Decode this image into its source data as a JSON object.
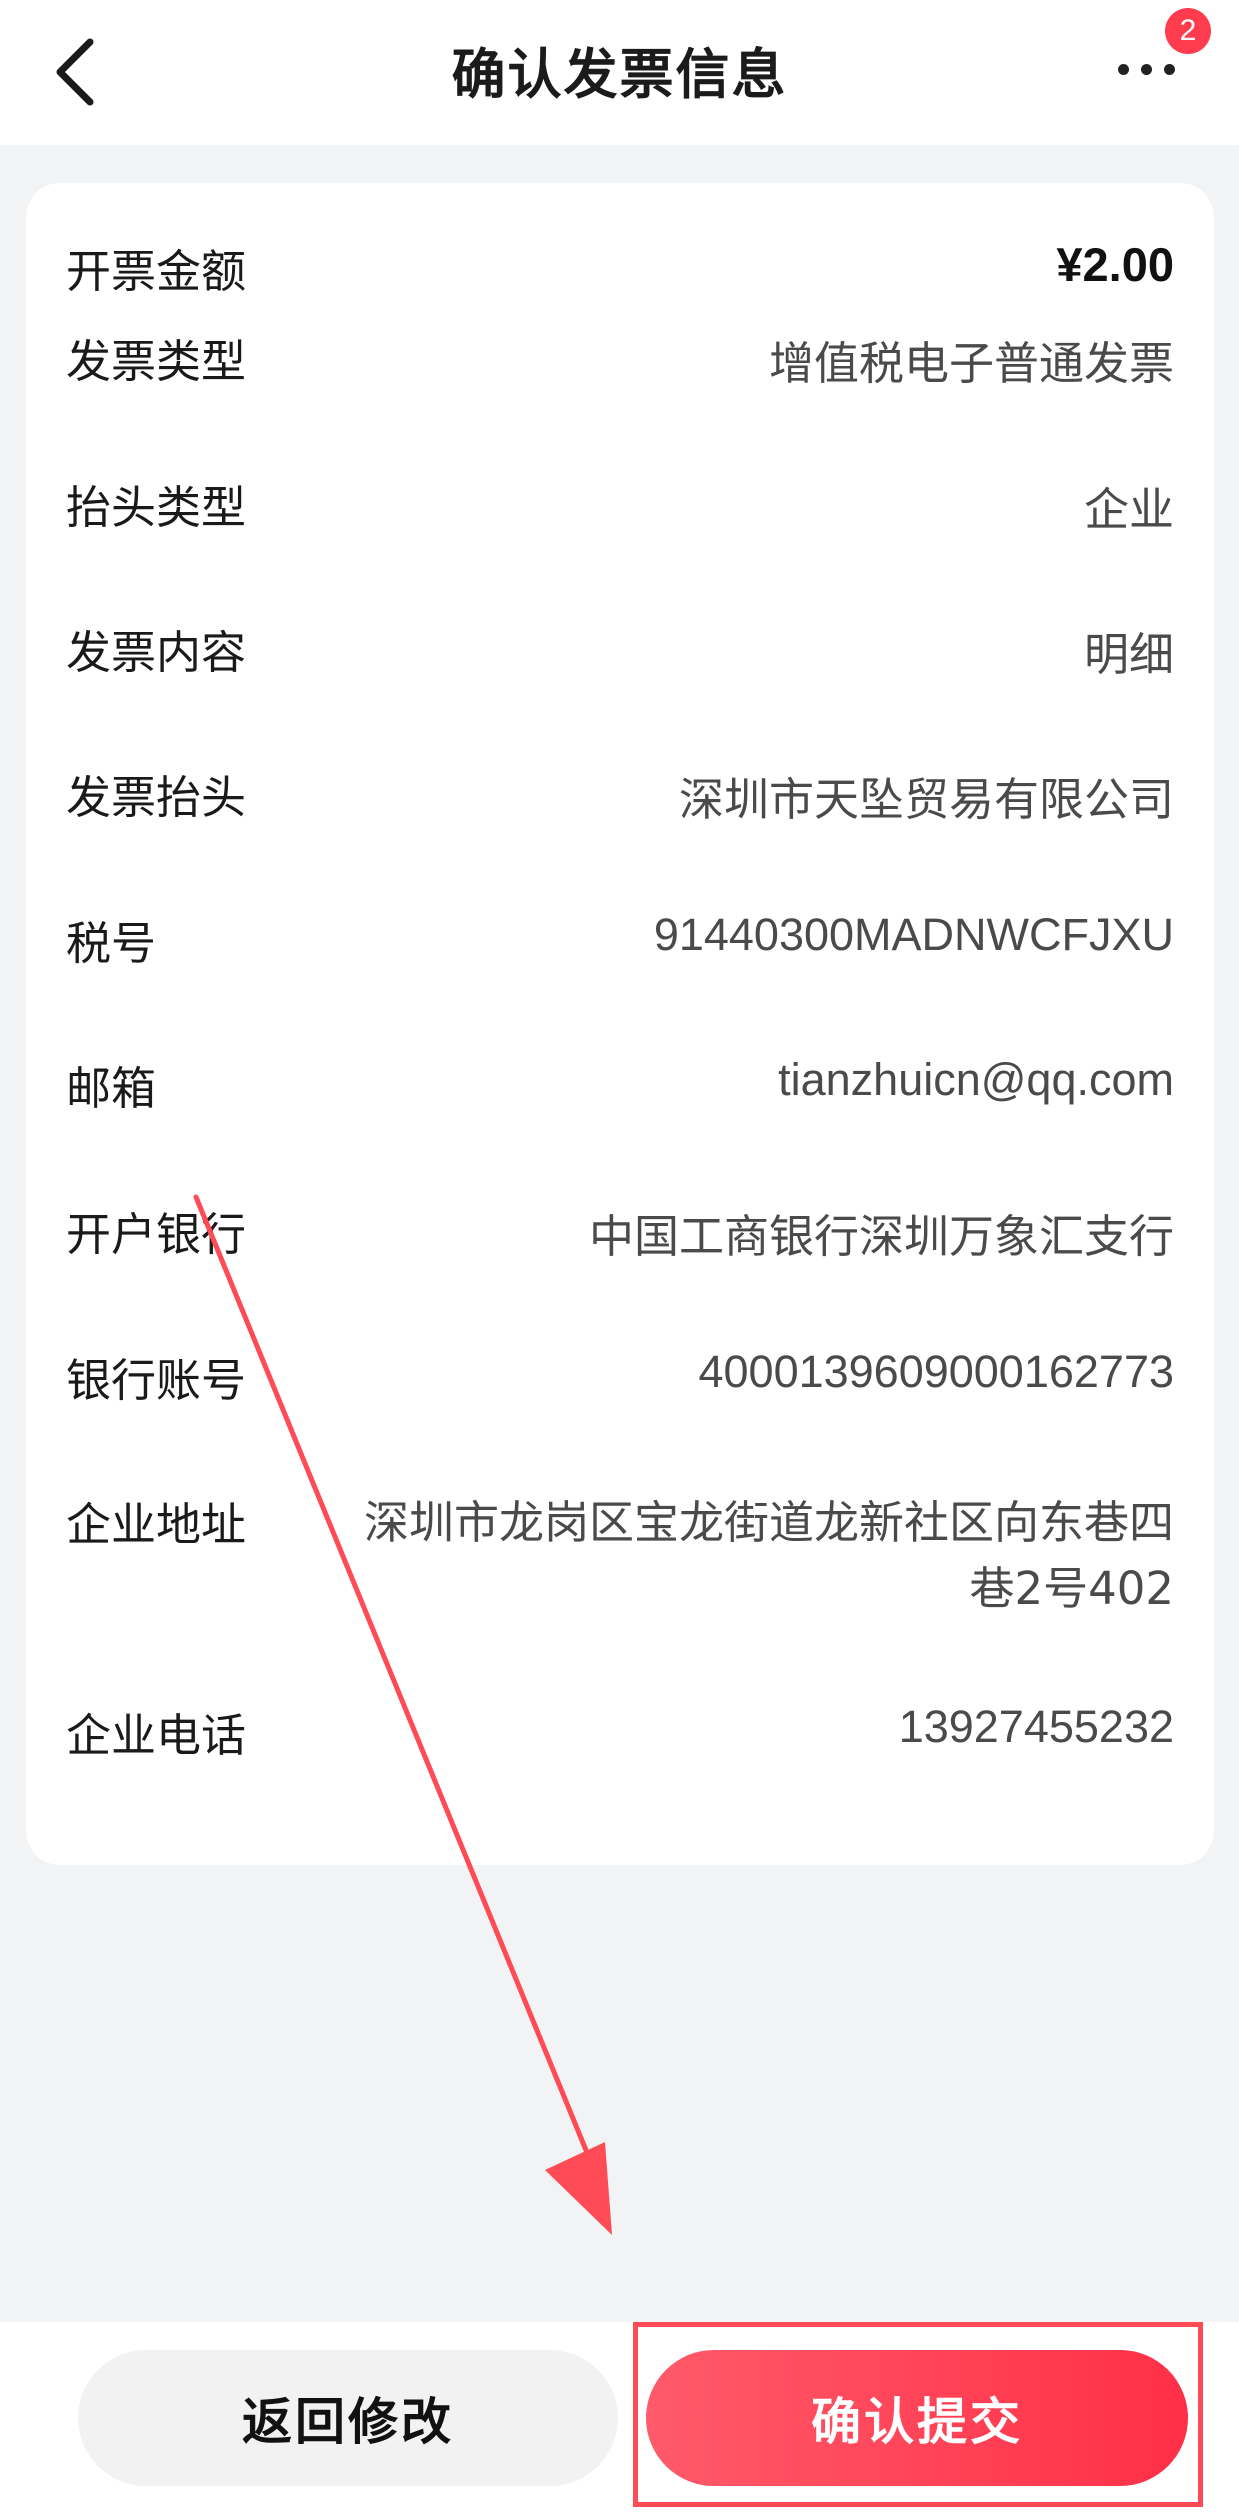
{
  "header": {
    "title": "确认发票信息",
    "notification_count": "2"
  },
  "invoice": {
    "rows": [
      {
        "label": "开票金额",
        "value": "¥2.00"
      },
      {
        "label": "发票类型",
        "value": "增值税电子普通发票"
      },
      {
        "label": "抬头类型",
        "value": "企业"
      },
      {
        "label": "发票内容",
        "value": "明细"
      },
      {
        "label": "发票抬头",
        "value": "深圳市天坠贸易有限公司"
      },
      {
        "label": "税号",
        "value": "91440300MADNWCFJXU"
      },
      {
        "label": "邮箱",
        "value": "tianzhuicn@qq.com"
      },
      {
        "label": "开户银行",
        "value": "中国工商银行深圳万象汇支行"
      },
      {
        "label": "银行账号",
        "value": "4000139609000162773"
      },
      {
        "label": "企业地址",
        "value": "深圳市龙岗区宝龙街道龙新社区向东巷四巷2号402"
      },
      {
        "label": "企业电话",
        "value": "13927455232"
      }
    ]
  },
  "actions": {
    "back_edit_label": "返回修改",
    "confirm_label": "确认提交"
  },
  "colors": {
    "accent": "#ff3b4e",
    "annotation": "#ff4b55"
  }
}
